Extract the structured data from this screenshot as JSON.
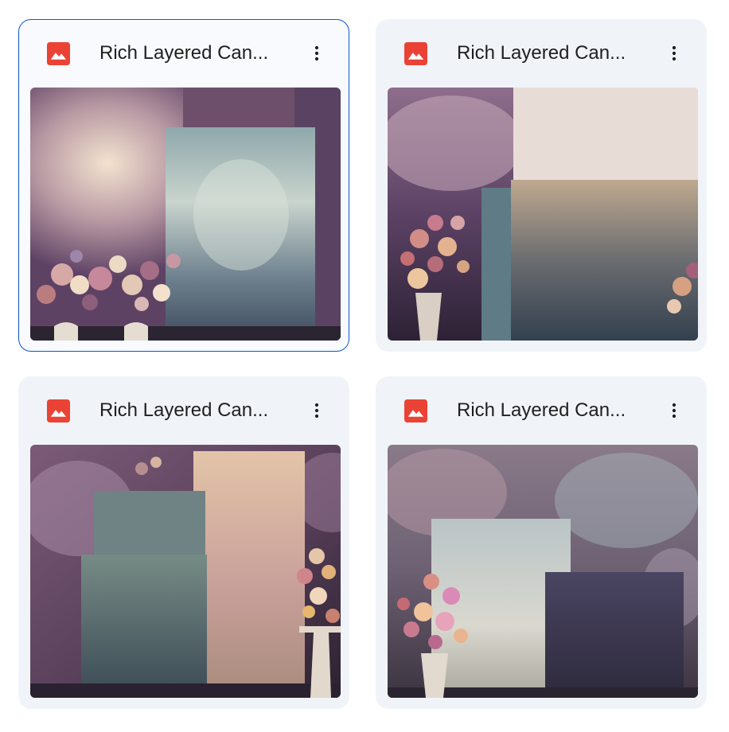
{
  "files": [
    {
      "title": "Rich Layered Can...",
      "type_icon": "image-file-icon",
      "menu_icon": "more-vert-icon",
      "selected": true
    },
    {
      "title": "Rich Layered Can...",
      "type_icon": "image-file-icon",
      "menu_icon": "more-vert-icon",
      "selected": false
    },
    {
      "title": "Rich Layered Can...",
      "type_icon": "image-file-icon",
      "menu_icon": "more-vert-icon",
      "selected": false
    },
    {
      "title": "Rich Layered Can...",
      "type_icon": "image-file-icon",
      "menu_icon": "more-vert-icon",
      "selected": false
    }
  ],
  "colors": {
    "card_bg": "#f0f4f9",
    "selected_border": "#0b57d0",
    "image_icon": "#ea4335",
    "title_text": "#1f1f1f"
  }
}
